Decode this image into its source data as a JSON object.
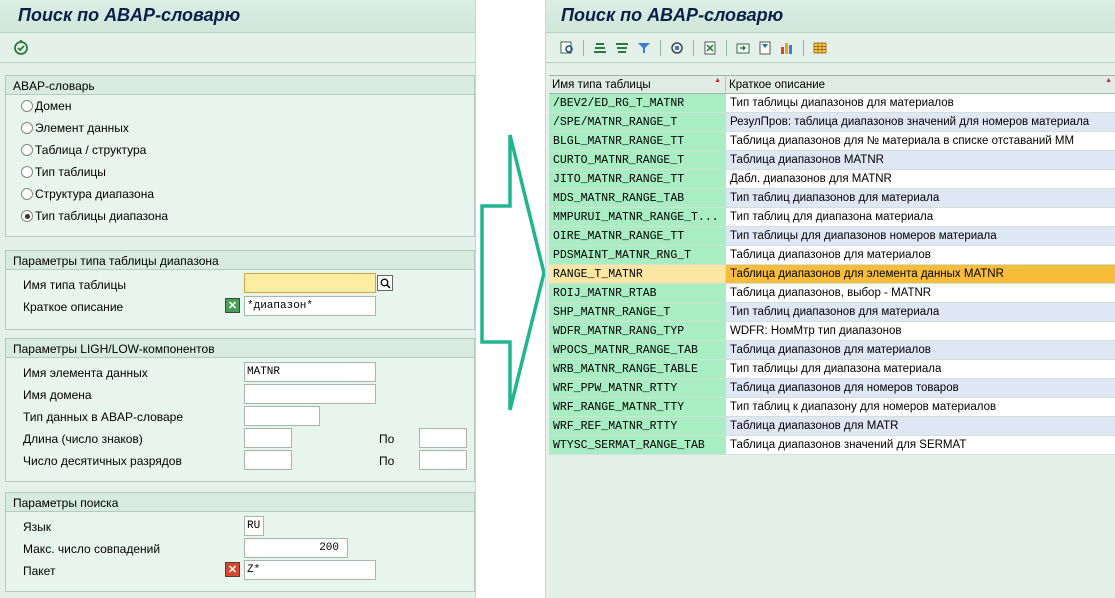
{
  "left": {
    "title": "Поиск по ABAP-словарю",
    "toolbar_icon": "execute-icon",
    "group_dictionary": {
      "title": "ABAP-словарь",
      "options": [
        {
          "label": "Домен",
          "selected": false
        },
        {
          "label": "Элемент данных",
          "selected": false
        },
        {
          "label": "Таблица / структура",
          "selected": false
        },
        {
          "label": "Тип таблицы",
          "selected": false
        },
        {
          "label": "Структура диапазона",
          "selected": false
        },
        {
          "label": "Тип таблицы диапазона",
          "selected": true
        }
      ]
    },
    "group_range_type": {
      "title": "Параметры типа таблицы диапазона",
      "name_label": "Имя типа таблицы",
      "name_value": "",
      "desc_label": "Краткое описание",
      "desc_value": "*диапазон*"
    },
    "group_components": {
      "title": "Параметры LIGH/LOW-компонентов",
      "data_element_label": "Имя элемента данных",
      "data_element_value": "MATNR",
      "domain_label": "Имя домена",
      "domain_value": "",
      "datatype_label": "Тип данных в ABAP-словаре",
      "datatype_value": "",
      "length_label": "Длина (число знаков)",
      "length_from": "",
      "length_to_label": "По",
      "length_to": "",
      "decimals_label": "Число десятичных разрядов",
      "decimals_from": "",
      "decimals_to_label": "По",
      "decimals_to": ""
    },
    "group_search": {
      "title": "Параметры поиска",
      "lang_label": "Язык",
      "lang_value": "RU",
      "max_label": "Макс. число совпадений",
      "max_value": "200",
      "package_label": "Пакет",
      "package_value": "Z*"
    }
  },
  "right": {
    "title": "Поиск по ABAP-словарю",
    "toolbar_icons": [
      "details-icon",
      "sort-ascending-icon",
      "sort-descending-icon",
      "filter-icon",
      "sum-icon",
      "export-excel-icon",
      "print-icon",
      "layout-icon",
      "chart-icon",
      "grid-icon"
    ],
    "columns": [
      "Имя типа таблицы",
      "Краткое описание"
    ],
    "selected_index": 9,
    "rows": [
      [
        "/BEV2/ED_RG_T_MATNR",
        "Тип таблицы диапазонов для материалов"
      ],
      [
        "/SPE/MATNR_RANGE_T",
        "РезулПров: таблица диапазонов значений для номеров материала"
      ],
      [
        "BLGL_MATNR_RANGE_TT",
        "Таблица диапазонов для № материала в списке отставаний ММ"
      ],
      [
        "CURTO_MATNR_RANGE_T",
        "Таблица диапазонов MATNR"
      ],
      [
        "JITO_MATNR_RANGE_TT",
        "Дабл. диапазонов для MATNR"
      ],
      [
        "MDS_MATNR_RANGE_TAB",
        "Тип таблиц диапазонов для материала"
      ],
      [
        "MMPURUI_MATNR_RANGE_T...",
        "Тип таблиц для диапазона материала"
      ],
      [
        "OIRE_MATNR_RANGE_TT",
        "Тип таблицы для диапазонов номеров материала"
      ],
      [
        "PDSMAINT_MATNR_RNG_T",
        "Таблица диапазонов для материалов"
      ],
      [
        "RANGE_T_MATNR",
        "Таблица диапазонов для элемента данных MATNR"
      ],
      [
        "ROIJ_MATNR_RTAB",
        "Таблица диапазонов, выбор - MATNR"
      ],
      [
        "SHP_MATNR_RANGE_T",
        "Тип таблиц диапазонов для материала"
      ],
      [
        "WDFR_MATNR_RANG_TYP",
        "WDFR: НомМтр тип диапазонов"
      ],
      [
        "WPOCS_MATNR_RANGE_TAB",
        "Таблица диапазонов для материалов"
      ],
      [
        "WRB_MATNR_RANGE_TABLE",
        "Тип таблицы для диапазона материала"
      ],
      [
        "WRF_PPW_MATNR_RTTY",
        "Таблица диапазонов для номеров товаров"
      ],
      [
        "WRF_RANGE_MATNR_TTY",
        "Тип таблиц к диапазону для номеров материалов"
      ],
      [
        "WRF_REF_MATNR_RTTY",
        "Таблица диапазонов для MATR"
      ],
      [
        "WTYSC_SERMAT_RANGE_TAB",
        "Таблица диапазонов значений для SERMAT"
      ]
    ]
  },
  "colors": {
    "background": "#e3f1ea",
    "key_column": "#a9edc3",
    "selected_row": "#f9bd3c",
    "arrow": "#1fb58f"
  }
}
